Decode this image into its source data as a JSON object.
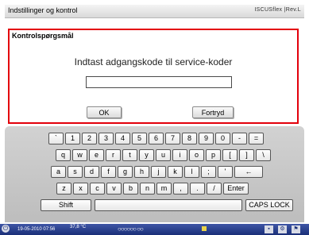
{
  "titlebar": {
    "title": "Indstillinger og kontrol",
    "brand": "ISCUSflex |Rev.L"
  },
  "dialog": {
    "title": "Kontrolspørgsmål",
    "prompt": "Indtast adgangskode til service-koder",
    "password_value": "",
    "ok_label": "OK",
    "cancel_label": "Fortryd"
  },
  "keyboard": {
    "row1": [
      "`",
      "1",
      "2",
      "3",
      "4",
      "5",
      "6",
      "7",
      "8",
      "9",
      "0",
      "-",
      "="
    ],
    "row2": [
      "q",
      "w",
      "e",
      "r",
      "t",
      "y",
      "u",
      "i",
      "o",
      "p",
      "[",
      "]",
      "\\"
    ],
    "row3": [
      "a",
      "s",
      "d",
      "f",
      "g",
      "h",
      "j",
      "k",
      "l",
      ";",
      "'"
    ],
    "backspace": "←",
    "row4": [
      "z",
      "x",
      "c",
      "v",
      "b",
      "n",
      "m",
      ",",
      ".",
      "/"
    ],
    "enter": "Enter",
    "shift": "Shift",
    "space": "",
    "caps": "CAPS LOCK"
  },
  "statusbar": {
    "power_icon": "⏻",
    "datetime": "19-05-2010 07:56",
    "temperature": "37,8 °C",
    "indicators": "○○○○○○ ○○"
  }
}
